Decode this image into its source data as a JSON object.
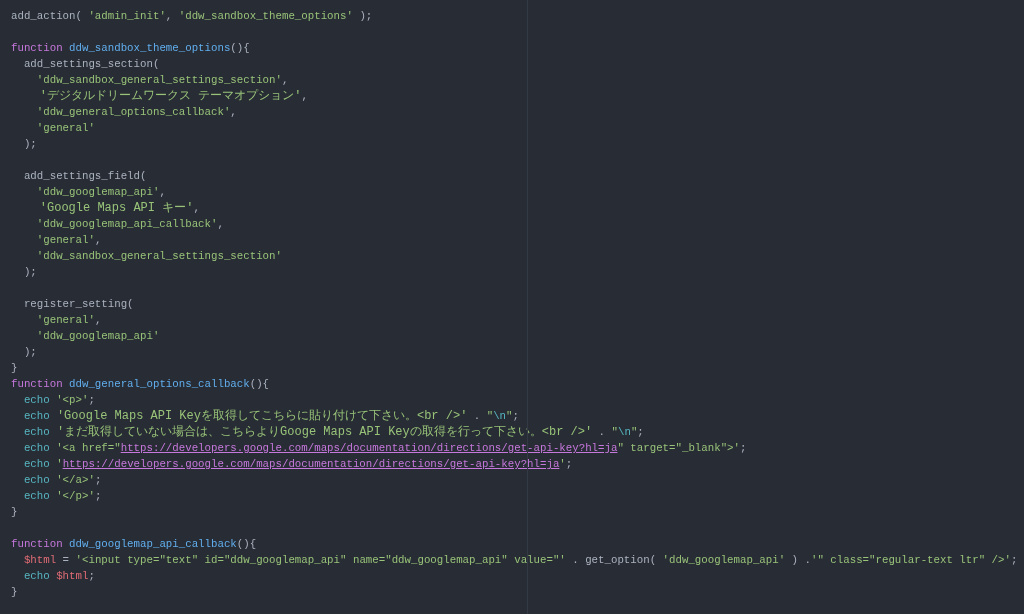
{
  "editor": {
    "lines": [
      {
        "kind": "code",
        "tokens": [
          {
            "kind": "plain",
            "text": "add_action( "
          },
          {
            "kind": "string",
            "text": "'admin_init'"
          },
          {
            "kind": "plain",
            "text": ", "
          },
          {
            "kind": "string",
            "text": "'ddw_sandbox_theme_options'"
          },
          {
            "kind": "plain",
            "text": " );"
          }
        ]
      },
      {
        "kind": "blank"
      },
      {
        "kind": "code",
        "tokens": [
          {
            "kind": "keyword",
            "text": "function"
          },
          {
            "kind": "function",
            "text": " ddw_sandbox_theme_options"
          },
          {
            "kind": "plain",
            "text": "(){"
          }
        ]
      },
      {
        "kind": "code",
        "tokens": [
          {
            "kind": "plain",
            "text": "  add_settings_section("
          }
        ]
      },
      {
        "kind": "code",
        "tokens": [
          {
            "kind": "string",
            "text": "    'ddw_sandbox_general_settings_section'"
          },
          {
            "kind": "plain",
            "text": ","
          }
        ]
      },
      {
        "kind": "code",
        "tokens": [
          {
            "kind": "string",
            "text": "    'デジタルドリームワークス テーマオプション'"
          },
          {
            "kind": "plain",
            "text": ","
          }
        ]
      },
      {
        "kind": "code",
        "tokens": [
          {
            "kind": "string",
            "text": "    'ddw_general_options_callback'"
          },
          {
            "kind": "plain",
            "text": ","
          }
        ]
      },
      {
        "kind": "code",
        "tokens": [
          {
            "kind": "string",
            "text": "    'general'"
          }
        ]
      },
      {
        "kind": "code",
        "tokens": [
          {
            "kind": "plain",
            "text": "  );"
          }
        ]
      },
      {
        "kind": "blank"
      },
      {
        "kind": "code",
        "tokens": [
          {
            "kind": "plain",
            "text": "  add_settings_field("
          }
        ]
      },
      {
        "kind": "code",
        "tokens": [
          {
            "kind": "string",
            "text": "    'ddw_googlemap_api'"
          },
          {
            "kind": "plain",
            "text": ","
          }
        ]
      },
      {
        "kind": "code",
        "tokens": [
          {
            "kind": "string",
            "text": "    'Google Maps API キー'"
          },
          {
            "kind": "plain",
            "text": ","
          }
        ]
      },
      {
        "kind": "code",
        "tokens": [
          {
            "kind": "string",
            "text": "    'ddw_googlemap_api_callback'"
          },
          {
            "kind": "plain",
            "text": ","
          }
        ]
      },
      {
        "kind": "code",
        "tokens": [
          {
            "kind": "string",
            "text": "    'general'"
          },
          {
            "kind": "plain",
            "text": ","
          }
        ]
      },
      {
        "kind": "code",
        "tokens": [
          {
            "kind": "string",
            "text": "    'ddw_sandbox_general_settings_section'"
          }
        ]
      },
      {
        "kind": "code",
        "tokens": [
          {
            "kind": "plain",
            "text": "  );"
          }
        ]
      },
      {
        "kind": "blank"
      },
      {
        "kind": "code",
        "tokens": [
          {
            "kind": "plain",
            "text": "  register_setting("
          }
        ]
      },
      {
        "kind": "code",
        "tokens": [
          {
            "kind": "string",
            "text": "    'general'"
          },
          {
            "kind": "plain",
            "text": ","
          }
        ]
      },
      {
        "kind": "code",
        "tokens": [
          {
            "kind": "string",
            "text": "    'ddw_googlemap_api'"
          }
        ]
      },
      {
        "kind": "code",
        "tokens": [
          {
            "kind": "plain",
            "text": "  );"
          }
        ]
      },
      {
        "kind": "code",
        "tokens": [
          {
            "kind": "plain",
            "text": "}"
          }
        ]
      },
      {
        "kind": "code",
        "tokens": [
          {
            "kind": "keyword",
            "text": "function"
          },
          {
            "kind": "function",
            "text": " ddw_general_options_callback"
          },
          {
            "kind": "plain",
            "text": "(){"
          }
        ]
      },
      {
        "kind": "code",
        "tokens": [
          {
            "kind": "builtin",
            "text": "  echo"
          },
          {
            "kind": "string",
            "text": " '<p>'"
          },
          {
            "kind": "plain",
            "text": ";"
          }
        ]
      },
      {
        "kind": "code",
        "tokens": [
          {
            "kind": "builtin",
            "text": "  echo"
          },
          {
            "kind": "string",
            "text": " 'Google Maps API Keyを取得してこちらに貼り付けて下さい。<br />'"
          },
          {
            "kind": "plain",
            "text": " . "
          },
          {
            "kind": "string",
            "text": "\""
          },
          {
            "kind": "escape",
            "text": "\\n"
          },
          {
            "kind": "string",
            "text": "\""
          },
          {
            "kind": "plain",
            "text": ";"
          }
        ]
      },
      {
        "kind": "code",
        "tokens": [
          {
            "kind": "builtin",
            "text": "  echo"
          },
          {
            "kind": "string",
            "text": " 'まだ取得していない場合は、こちらよりGooge Maps API Keyの取得を行って下さい。<br />'"
          },
          {
            "kind": "plain",
            "text": " . "
          },
          {
            "kind": "string",
            "text": "\""
          },
          {
            "kind": "escape",
            "text": "\\n"
          },
          {
            "kind": "string",
            "text": "\""
          },
          {
            "kind": "plain",
            "text": ";"
          }
        ]
      },
      {
        "kind": "code",
        "tokens": [
          {
            "kind": "builtin",
            "text": "  echo"
          },
          {
            "kind": "string",
            "text": " '<a href=\""
          },
          {
            "kind": "url",
            "text": "https://developers.google.com/maps/documentation/directions/get-api-key?hl=ja"
          },
          {
            "kind": "string",
            "text": "\" target=\"_blank\">'"
          },
          {
            "kind": "plain",
            "text": ";"
          }
        ]
      },
      {
        "kind": "code",
        "tokens": [
          {
            "kind": "builtin",
            "text": "  echo"
          },
          {
            "kind": "string",
            "text": " '"
          },
          {
            "kind": "url",
            "text": "https://developers.google.com/maps/documentation/directions/get-api-key?hl=ja"
          },
          {
            "kind": "string",
            "text": "'"
          },
          {
            "kind": "plain",
            "text": ";"
          }
        ]
      },
      {
        "kind": "code",
        "tokens": [
          {
            "kind": "builtin",
            "text": "  echo"
          },
          {
            "kind": "string",
            "text": " '</a>'"
          },
          {
            "kind": "plain",
            "text": ";"
          }
        ]
      },
      {
        "kind": "code",
        "tokens": [
          {
            "kind": "builtin",
            "text": "  echo"
          },
          {
            "kind": "string",
            "text": " '</p>'"
          },
          {
            "kind": "plain",
            "text": ";"
          }
        ]
      },
      {
        "kind": "code",
        "tokens": [
          {
            "kind": "plain",
            "text": "}"
          }
        ]
      },
      {
        "kind": "blank"
      },
      {
        "kind": "code",
        "tokens": [
          {
            "kind": "keyword",
            "text": "function"
          },
          {
            "kind": "function",
            "text": " ddw_googlemap_api_callback"
          },
          {
            "kind": "plain",
            "text": "(){"
          }
        ]
      },
      {
        "kind": "code",
        "tokens": [
          {
            "kind": "variable",
            "text": "  $html"
          },
          {
            "kind": "plain",
            "text": " = "
          },
          {
            "kind": "string",
            "text": "'<input type=\"text\" id=\"ddw_googlemap_api\" name=\"ddw_googlemap_api\" value=\"'"
          },
          {
            "kind": "plain",
            "text": " . get_option( "
          },
          {
            "kind": "string",
            "text": "'ddw_googlemap_api'"
          },
          {
            "kind": "plain",
            "text": " ) ."
          },
          {
            "kind": "string",
            "text": "'\" class=\"regular-text ltr\" />'"
          },
          {
            "kind": "plain",
            "text": ";"
          }
        ]
      },
      {
        "kind": "code",
        "tokens": [
          {
            "kind": "builtin",
            "text": "  echo"
          },
          {
            "kind": "variable",
            "text": " $html"
          },
          {
            "kind": "plain",
            "text": ";"
          }
        ]
      },
      {
        "kind": "code",
        "tokens": [
          {
            "kind": "plain",
            "text": "}"
          }
        ]
      }
    ]
  }
}
